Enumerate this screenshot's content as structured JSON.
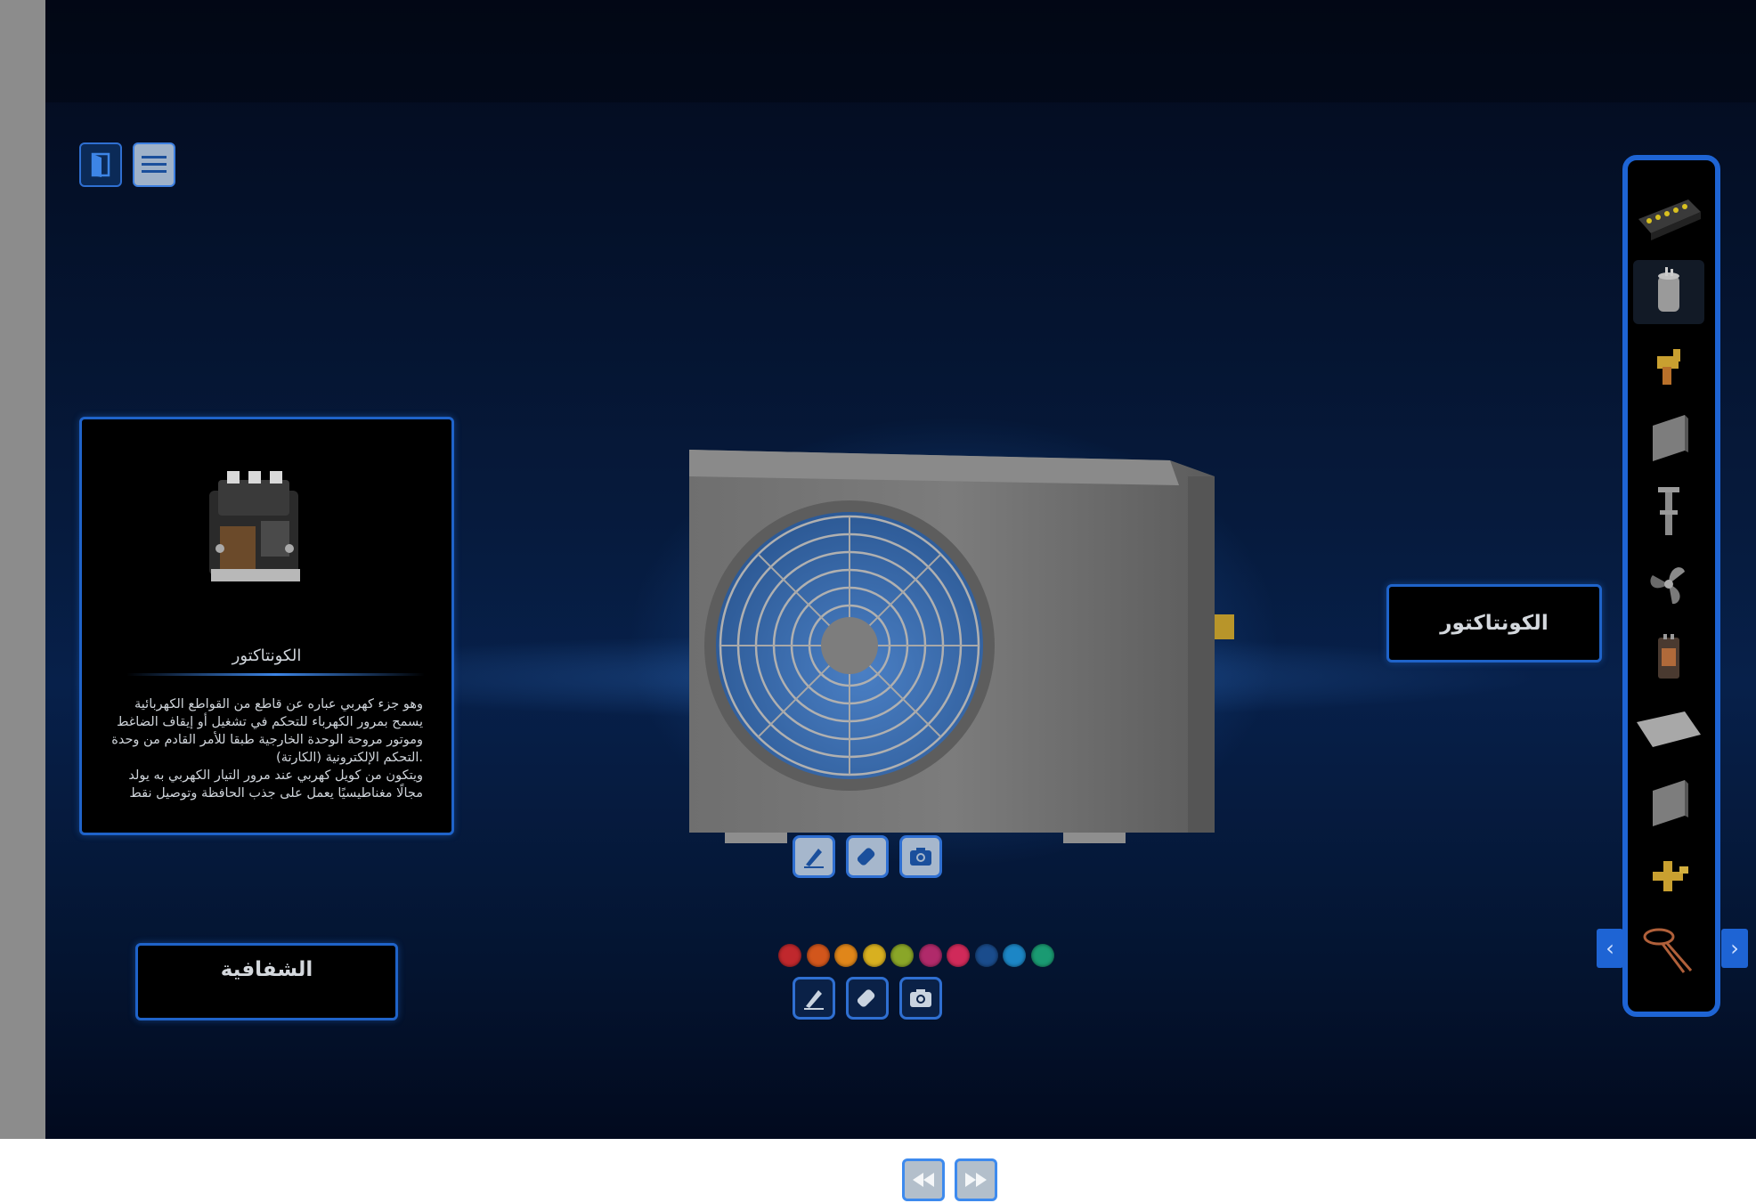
{
  "info_panel": {
    "title": "الكونتاكتور",
    "description_lines": [
      "وهو جزء كهربي عباره عن قاطع من القواطع الكهربائية",
      "يسمح بمرور الكهرباء للتحكم في تشغيل أو إيقاف الضاغط",
      "وموتور مروحة الوحدة الخارجية طبقا للأمر القادم من وحدة",
      ".التحكم الإلكترونية (الكارتة)",
      "ويتكون من كويل كهربي عند مرور التيار الكهربي به يولد",
      "مجالًا مغناطيسيًا يعمل على جذب الحافظة وتوصيل نقط"
    ]
  },
  "transparency_button": {
    "label": "الشفافية"
  },
  "part_label": {
    "text": "الكونتاكتور"
  },
  "color_swatches": [
    "#c0282d",
    "#d2561c",
    "#e0861a",
    "#d8b020",
    "#8aa628",
    "#b02a6a",
    "#d02a5a",
    "#1a4c8c",
    "#1c86c6",
    "#1a9a72"
  ],
  "parts_list": [
    {
      "icon": "terminal-block-icon"
    },
    {
      "icon": "capacitor-icon",
      "selected": true
    },
    {
      "icon": "valve-icon"
    },
    {
      "icon": "metal-panel-icon"
    },
    {
      "icon": "bracket-icon"
    },
    {
      "icon": "fan-blade-icon"
    },
    {
      "icon": "contactor-icon"
    },
    {
      "icon": "plate-icon"
    },
    {
      "icon": "side-panel-icon"
    },
    {
      "icon": "service-valve-icon"
    },
    {
      "icon": "copper-coil-icon"
    }
  ],
  "colors": {
    "accent": "#1e64d4",
    "panel_bg": "#000000",
    "stage_bg": "#061a3c"
  }
}
